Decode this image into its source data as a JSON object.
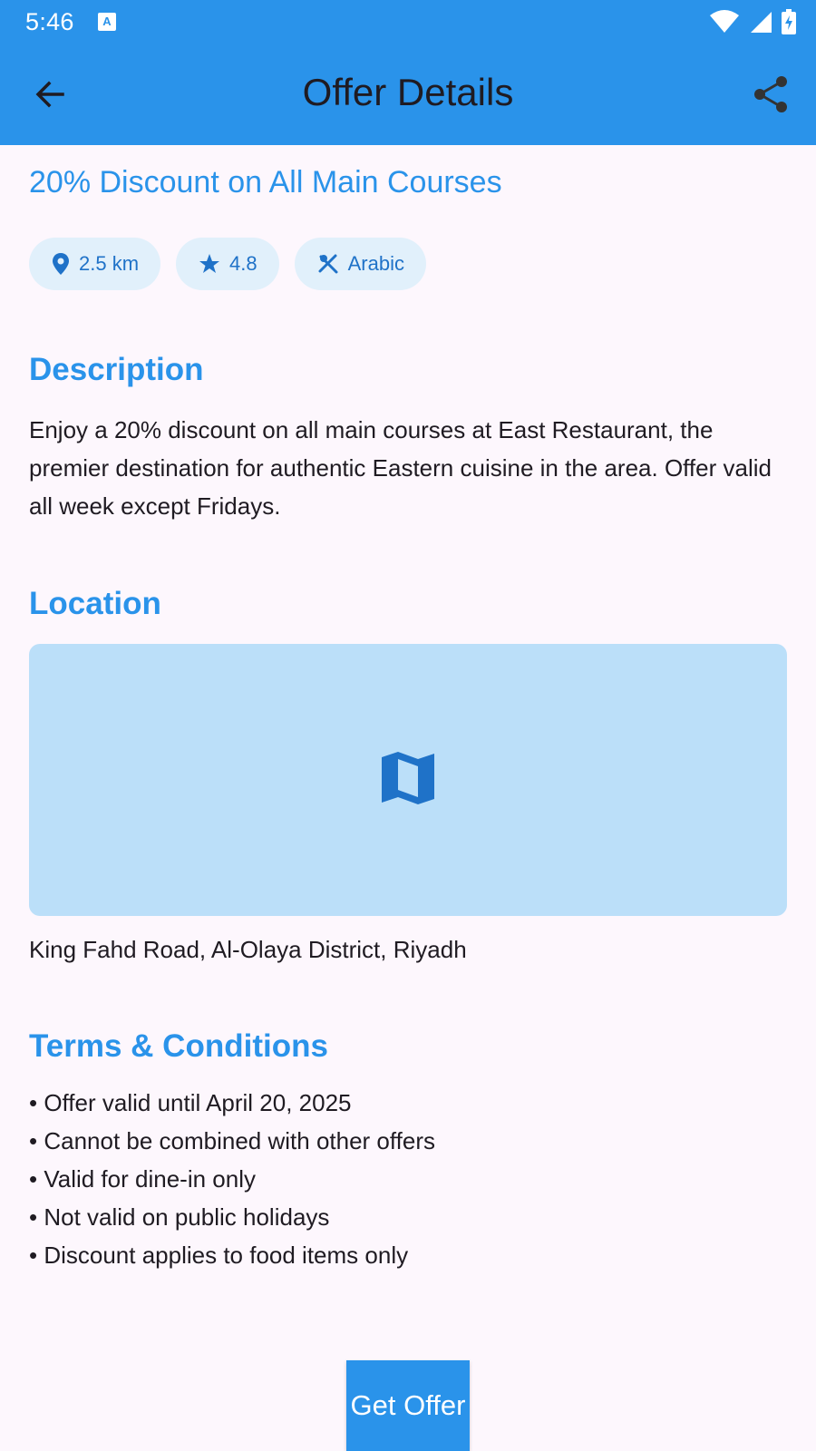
{
  "status_bar": {
    "time": "5:46",
    "icons": [
      "notification-a-icon",
      "wifi-icon",
      "signal-icon",
      "battery-charging-icon"
    ]
  },
  "app_bar": {
    "title": "Offer Details",
    "back_icon": "arrow-back-icon",
    "share_icon": "share-icon"
  },
  "offer": {
    "title": "20% Discount on All Main Courses",
    "chips": [
      {
        "icon": "location-pin-icon",
        "label": "2.5 km"
      },
      {
        "icon": "star-icon",
        "label": "4.8"
      },
      {
        "icon": "restaurant-icon",
        "label": "Arabic"
      }
    ]
  },
  "description": {
    "heading": "Description",
    "text": "Enjoy a 20% discount on all main courses at East Restaurant, the premier destination for authentic Eastern cuisine in the area. Offer valid all week except Fridays."
  },
  "location": {
    "heading": "Location",
    "map_icon": "map-icon",
    "address": "King Fahd Road, Al-Olaya District, Riyadh"
  },
  "terms": {
    "heading": "Terms & Conditions",
    "items": [
      "• Offer valid until April 20, 2025",
      "• Cannot be combined with other offers",
      "• Valid for dine-in only",
      "• Not valid on public holidays",
      "• Discount applies to food items only"
    ]
  },
  "cta": {
    "label": "Get Offer"
  },
  "colors": {
    "primary": "#2a93ea",
    "chip_bg": "#e1f0fb",
    "chip_fg": "#1f72c8",
    "map_bg": "#bbdff9",
    "page_bg": "#fdf7fd"
  }
}
